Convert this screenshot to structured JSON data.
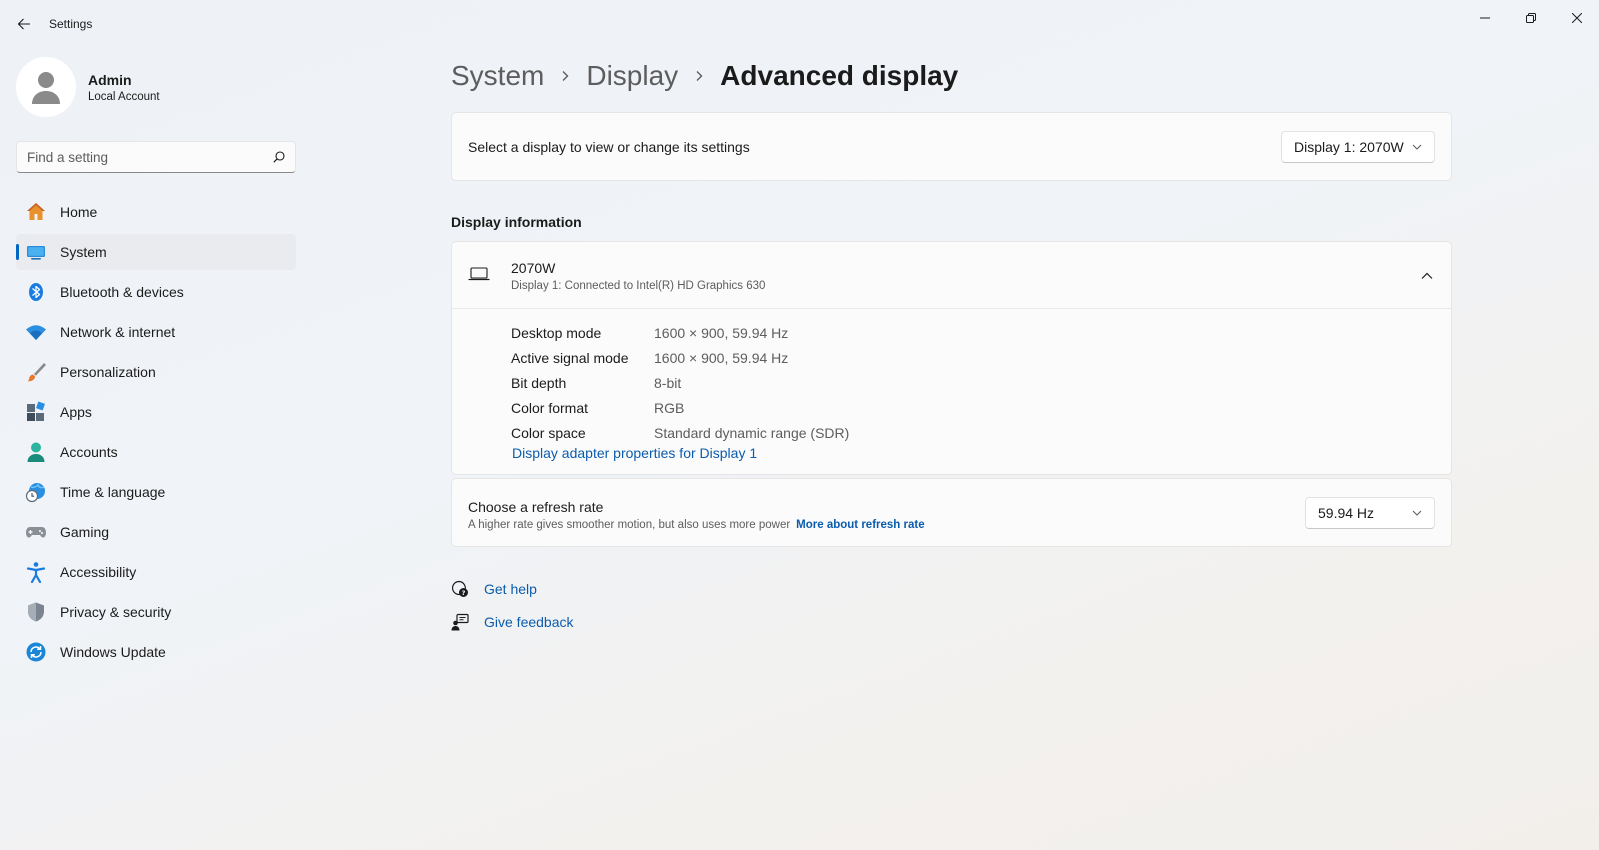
{
  "app": {
    "title": "Settings"
  },
  "profile": {
    "name": "Admin",
    "account_type": "Local Account"
  },
  "search": {
    "placeholder": "Find a setting"
  },
  "sidebar": {
    "items": [
      {
        "label": "Home",
        "icon": "home-icon"
      },
      {
        "label": "System",
        "icon": "system-icon",
        "active": true
      },
      {
        "label": "Bluetooth & devices",
        "icon": "bluetooth-icon"
      },
      {
        "label": "Network & internet",
        "icon": "wifi-icon"
      },
      {
        "label": "Personalization",
        "icon": "brush-icon"
      },
      {
        "label": "Apps",
        "icon": "apps-icon"
      },
      {
        "label": "Accounts",
        "icon": "accounts-icon"
      },
      {
        "label": "Time & language",
        "icon": "globe-clock-icon"
      },
      {
        "label": "Gaming",
        "icon": "controller-icon"
      },
      {
        "label": "Accessibility",
        "icon": "accessibility-icon"
      },
      {
        "label": "Privacy & security",
        "icon": "shield-icon"
      },
      {
        "label": "Windows Update",
        "icon": "update-icon"
      }
    ]
  },
  "breadcrumb": {
    "level1": "System",
    "level2": "Display",
    "current": "Advanced display"
  },
  "display_select": {
    "label": "Select a display to view or change its settings",
    "selected": "Display 1: 2070W"
  },
  "display_info": {
    "section_title": "Display information",
    "monitor_name": "2070W",
    "connection": "Display 1: Connected to Intel(R) HD Graphics 630",
    "rows": [
      {
        "key": "Desktop mode",
        "value": "1600 × 900, 59.94 Hz"
      },
      {
        "key": "Active signal mode",
        "value": "1600 × 900, 59.94 Hz"
      },
      {
        "key": "Bit depth",
        "value": "8-bit"
      },
      {
        "key": "Color format",
        "value": "RGB"
      },
      {
        "key": "Color space",
        "value": "Standard dynamic range (SDR)"
      }
    ],
    "adapter_link": "Display adapter properties for Display 1"
  },
  "refresh_rate": {
    "label": "Choose a refresh rate",
    "description": "A higher rate gives smoother motion, but also uses more power",
    "link": "More about refresh rate",
    "selected": "59.94 Hz"
  },
  "help": {
    "get_help": "Get help",
    "give_feedback": "Give feedback"
  },
  "colors": {
    "accent": "#0067c0",
    "link": "#0b5cad"
  }
}
